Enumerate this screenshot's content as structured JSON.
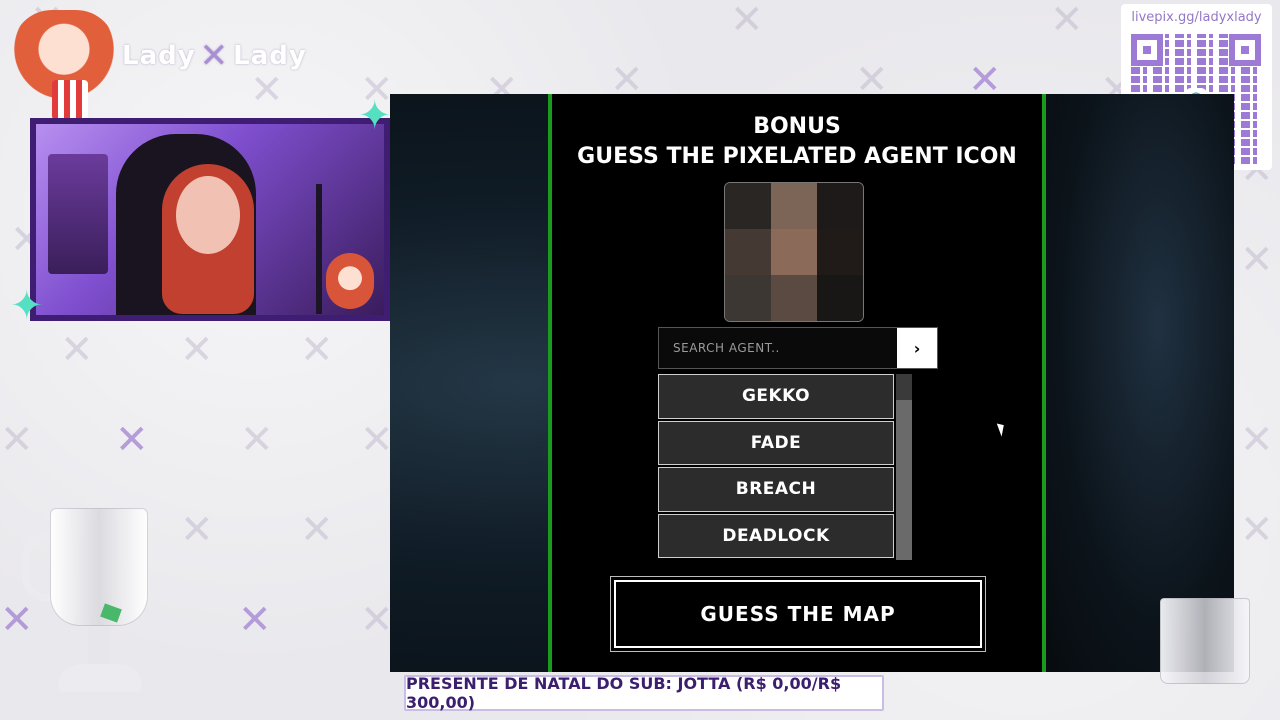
{
  "brand": {
    "left": "Lady",
    "right": "Lady"
  },
  "donation": {
    "url": "livepix.gg/ladyxlady"
  },
  "game": {
    "bonus_label": "BONUS",
    "title": "GUESS THE PIXELATED AGENT ICON",
    "search": {
      "placeholder": "SEARCH AGENT..",
      "submit_icon": "chevron-right-icon"
    },
    "agents": [
      "GEKKO",
      "FADE",
      "BREACH",
      "DEADLOCK"
    ],
    "guess_map_label": "GUESS THE MAP",
    "pixel_colors": [
      "#2a2624",
      "#7c6557",
      "#1d1a19",
      "#453a33",
      "#8c6a5a",
      "#201b19",
      "#3d3733",
      "#5a4a41",
      "#191716"
    ]
  },
  "ticker": {
    "text": "PRESENTE DE NATAL DO SUB: JOTTA (R$ 0,00/R$ 300,00)"
  },
  "colors": {
    "panel_border": "#1b9b1d",
    "accent_purple": "#3f1d72",
    "qr_purple": "#9c7ad6"
  }
}
